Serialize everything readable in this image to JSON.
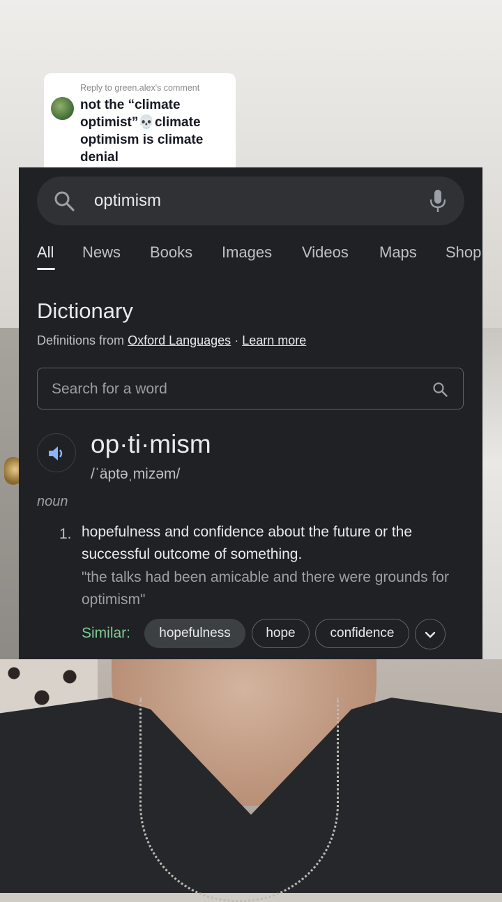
{
  "reply": {
    "header": "Reply to green.alex's comment",
    "text": "not the “climate optimist”💀climate optimism is climate denial"
  },
  "search": {
    "query": "optimism"
  },
  "tabs": [
    {
      "label": "All",
      "active": true
    },
    {
      "label": "News"
    },
    {
      "label": "Books"
    },
    {
      "label": "Images"
    },
    {
      "label": "Videos"
    },
    {
      "label": "Maps"
    },
    {
      "label": "Shop"
    }
  ],
  "dictionary": {
    "title": "Dictionary",
    "source_prefix": "Definitions from",
    "source_link": "Oxford Languages",
    "separator": "·",
    "learn_more": "Learn more",
    "word_search_placeholder": "Search for a word",
    "headword": "op·ti·mism",
    "phonetic": "/ˈäptəˌmizəm/",
    "part_of_speech": "noun",
    "definitions": [
      {
        "number": "1.",
        "text": "hopefulness and confidence about the future or the successful outcome of something.",
        "example": "\"the talks had been amicable and there were grounds for optimism\""
      }
    ],
    "similar_label": "Similar:",
    "similar": [
      "hopefulness",
      "hope",
      "confidence"
    ]
  },
  "icons": {
    "search": "search-icon",
    "mic": "mic-icon",
    "speaker": "speaker-icon",
    "more": "chevron-down-icon"
  },
  "colors": {
    "panel_bg": "#202124",
    "searchbar_bg": "#303134",
    "similar_label": "#81c995",
    "speaker": "#8ab4f8"
  }
}
